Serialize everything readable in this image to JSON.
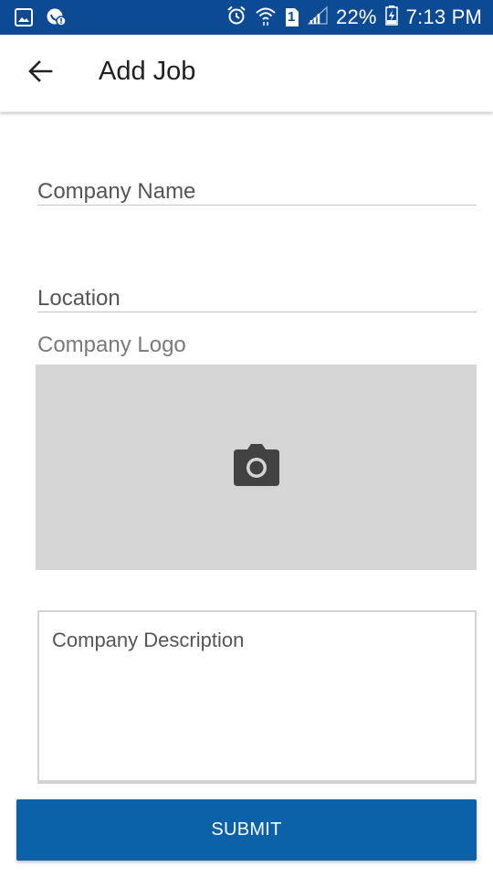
{
  "status_bar": {
    "battery": "22%",
    "time": "7:13 PM",
    "sim_slot": "1",
    "icons": [
      "gallery-icon",
      "whatsapp-icon",
      "alarm-icon",
      "wifi-icon",
      "sim-icon",
      "signal-icon",
      "battery-icon"
    ]
  },
  "app_bar": {
    "title": "Add Job",
    "back_icon": "arrow-back-icon"
  },
  "form": {
    "company_name": {
      "label": "Company Name",
      "value": ""
    },
    "location": {
      "label": "Location",
      "value": ""
    },
    "company_logo": {
      "label": "Company Logo",
      "icon": "camera-icon"
    },
    "company_description": {
      "placeholder": "Company Description",
      "value": ""
    }
  },
  "submit": {
    "label": "SUBMIT"
  },
  "colors": {
    "status_bar": "#0d4a94",
    "primary_button": "#0b62a9",
    "logo_placeholder": "#d5d5d5"
  }
}
